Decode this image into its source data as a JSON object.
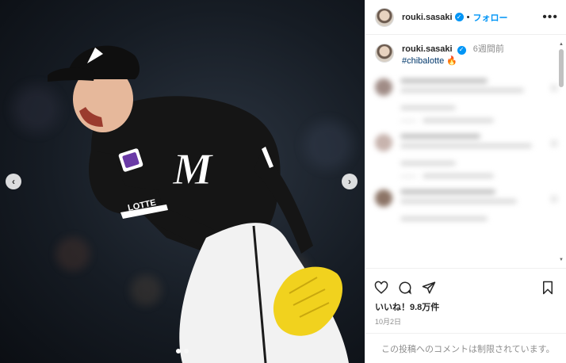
{
  "post": {
    "username": "rouki.sasaki",
    "follow_label": "フォロー",
    "more_label": "•••",
    "caption_hashtag": "#chibalotte",
    "caption_emoji": "🔥",
    "caption_time": "6週間前",
    "likes": "いいね！9.8万件",
    "date": "10月2日",
    "comments_disabled": "この投稿へのコメントは制限されています。"
  },
  "photo": {
    "jersey_logo": "M",
    "sleeve_text": "LOTTE",
    "colors": {
      "jersey": "#151515",
      "glove": "#f1d21e",
      "pants": "#f2f2f2",
      "trim": "#ffffff"
    }
  },
  "nav": {
    "prev_glyph": "‹",
    "next_glyph": "›"
  },
  "icons": [
    "heart-icon",
    "comment-icon",
    "share-icon",
    "bookmark-icon"
  ],
  "accent": "#0095f6"
}
